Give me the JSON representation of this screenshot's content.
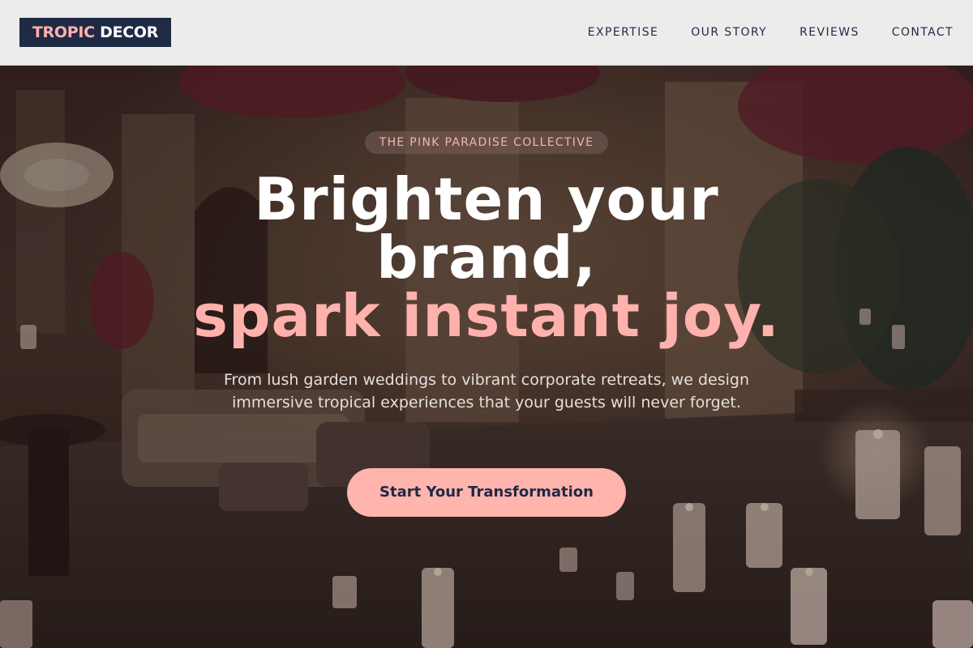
{
  "brand": {
    "part1": "TROPIC",
    "part2": "DECOR"
  },
  "nav": {
    "items": [
      {
        "label": "EXPERTISE"
      },
      {
        "label": "OUR STORY"
      },
      {
        "label": "REVIEWS"
      },
      {
        "label": "CONTACT"
      }
    ]
  },
  "hero": {
    "badge": "THE PINK PARADISE COLLECTIVE",
    "headline_line1": "Brighten your",
    "headline_line2": "brand,",
    "headline_accent": "spark instant joy.",
    "subtitle": "From lush garden weddings to vibrant corporate retreats, we design immersive tropical experiences that your guests will never forget.",
    "cta_label": "Start Your Transformation"
  },
  "colors": {
    "accent": "#ffb1ad",
    "navy": "#1f2a44",
    "header_bg": "#ececec"
  }
}
